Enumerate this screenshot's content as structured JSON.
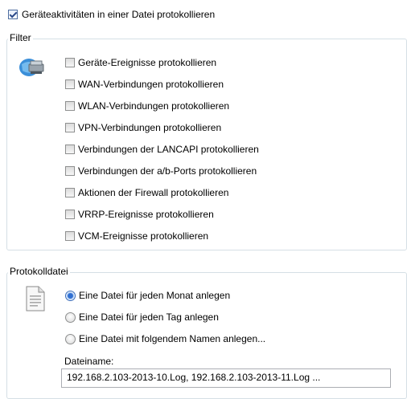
{
  "master_checkbox": {
    "label": "Geräteaktivitäten in einer Datei protokollieren",
    "checked": true
  },
  "filter": {
    "title": "Filter",
    "icon": "network-devices-icon",
    "items": [
      {
        "label": "Geräte-Ereignisse protokollieren",
        "checked": false
      },
      {
        "label": "WAN-Verbindungen protokollieren",
        "checked": false
      },
      {
        "label": "WLAN-Verbindungen protokollieren",
        "checked": false
      },
      {
        "label": "VPN-Verbindungen protokollieren",
        "checked": false
      },
      {
        "label": "Verbindungen der LANCAPI protokollieren",
        "checked": false
      },
      {
        "label": "Verbindungen der a/b-Ports protokollieren",
        "checked": false
      },
      {
        "label": "Aktionen der Firewall protokollieren",
        "checked": false
      },
      {
        "label": "VRRP-Ereignisse protokollieren",
        "checked": false
      },
      {
        "label": "VCM-Ereignisse protokollieren",
        "checked": false
      }
    ]
  },
  "logfile": {
    "title": "Protokolldatei",
    "icon": "document-icon",
    "options": [
      {
        "label": "Eine Datei für jeden Monat anlegen",
        "selected": true
      },
      {
        "label": "Eine Datei für jeden Tag anlegen",
        "selected": false
      },
      {
        "label": "Eine Datei mit folgendem Namen anlegen...",
        "selected": false
      }
    ],
    "filename_label": "Dateiname:",
    "filename_value": "192.168.2.103-2013-10.Log, 192.168.2.103-2013-11.Log ..."
  }
}
